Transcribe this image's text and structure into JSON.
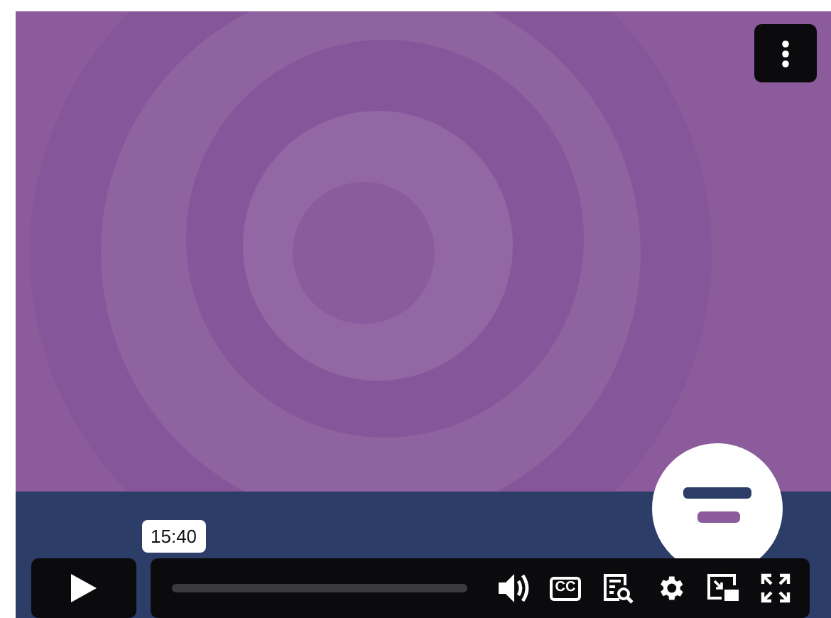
{
  "player": {
    "tooltip": "15:40",
    "progress": {
      "level": 0
    },
    "captions_label": "CC"
  }
}
